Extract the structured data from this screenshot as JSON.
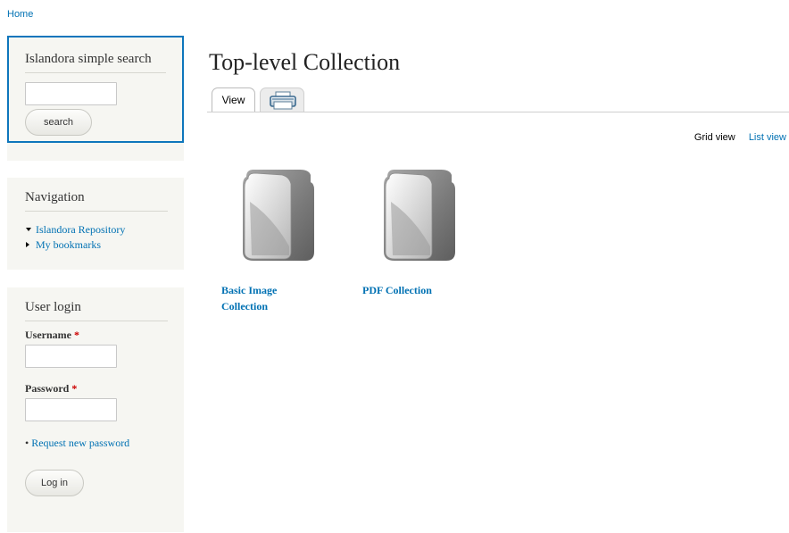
{
  "breadcrumb": {
    "home": "Home"
  },
  "search_block": {
    "title": "Islandora simple search",
    "input_value": "",
    "button_label": "search"
  },
  "navigation": {
    "title": "Navigation",
    "items": [
      {
        "label": "Islandora Repository",
        "expanded": true
      },
      {
        "label": "My bookmarks",
        "expanded": false
      }
    ]
  },
  "user_login": {
    "title": "User login",
    "username_label": "Username",
    "password_label": "Password",
    "required_mark": "*",
    "username_value": "",
    "password_value": "",
    "request_password": "Request new password",
    "login_button": "Log in"
  },
  "main": {
    "title": "Top-level Collection",
    "tabs": [
      {
        "label": "View",
        "active": true
      },
      {
        "label": "",
        "icon": "printer-icon",
        "active": false
      }
    ],
    "view_modes": {
      "grid": "Grid view",
      "list": "List view"
    },
    "collections": [
      {
        "title_line1": "Basic Image",
        "title_line2": "Collection",
        "icon": "folder-icon"
      },
      {
        "title_line1": "PDF Collection",
        "title_line2": "",
        "icon": "folder-icon"
      }
    ]
  },
  "colors": {
    "link": "#0071b3",
    "sidebar_bg": "#f6f6f2",
    "focus_border": "#0e76bc",
    "required": "#cc0000"
  }
}
